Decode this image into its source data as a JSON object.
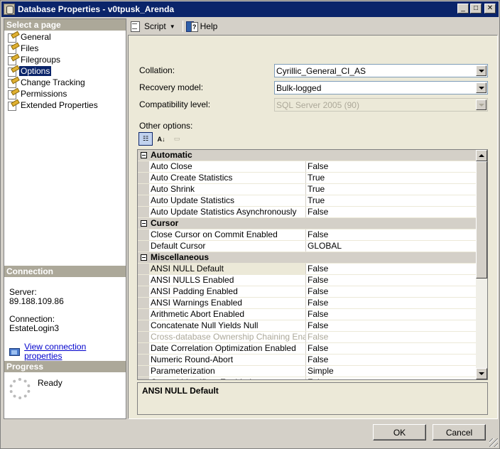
{
  "window": {
    "title": "Database Properties - v0tpusk_Arenda",
    "controls": {
      "minimize": "_",
      "maximize": "□",
      "close": "✕"
    }
  },
  "left": {
    "select_page_header": "Select a page",
    "pages": [
      {
        "label": "General",
        "icon": "page-settings-icon",
        "selected": false
      },
      {
        "label": "Files",
        "icon": "page-settings-icon",
        "selected": false
      },
      {
        "label": "Filegroups",
        "icon": "page-settings-icon",
        "selected": false
      },
      {
        "label": "Options",
        "icon": "page-settings-icon",
        "selected": true
      },
      {
        "label": "Change Tracking",
        "icon": "page-settings-icon",
        "selected": false
      },
      {
        "label": "Permissions",
        "icon": "page-settings-icon",
        "selected": false
      },
      {
        "label": "Extended Properties",
        "icon": "page-settings-icon",
        "selected": false
      }
    ],
    "connection_header": "Connection",
    "server_label": "Server:",
    "server_value": "89.188.109.86",
    "connection_label": "Connection:",
    "connection_value": "EstateLogin3",
    "view_connection_link": "View connection properties",
    "progress_header": "Progress",
    "progress_status": "Ready"
  },
  "toolbar": {
    "script_label": "Script",
    "help_label": "Help"
  },
  "form": {
    "collation_label": "Collation:",
    "collation_value": "Cyrillic_General_CI_AS",
    "recovery_label": "Recovery model:",
    "recovery_value": "Bulk-logged",
    "compat_label": "Compatibility level:",
    "compat_value": "SQL Server 2005 (90)",
    "other_options_label": "Other options:"
  },
  "grid": {
    "categories": [
      {
        "name": "Automatic",
        "rows": [
          {
            "name": "Auto Close",
            "value": "False"
          },
          {
            "name": "Auto Create Statistics",
            "value": "True"
          },
          {
            "name": "Auto Shrink",
            "value": "True"
          },
          {
            "name": "Auto Update Statistics",
            "value": "True"
          },
          {
            "name": "Auto Update Statistics Asynchronously",
            "value": "False"
          }
        ]
      },
      {
        "name": "Cursor",
        "rows": [
          {
            "name": "Close Cursor on Commit Enabled",
            "value": "False"
          },
          {
            "name": "Default Cursor",
            "value": "GLOBAL"
          }
        ]
      },
      {
        "name": "Miscellaneous",
        "rows": [
          {
            "name": "ANSI NULL Default",
            "value": "False",
            "selected": true
          },
          {
            "name": "ANSI NULLS Enabled",
            "value": "False"
          },
          {
            "name": "ANSI Padding Enabled",
            "value": "False"
          },
          {
            "name": "ANSI Warnings Enabled",
            "value": "False"
          },
          {
            "name": "Arithmetic Abort Enabled",
            "value": "False"
          },
          {
            "name": "Concatenate Null Yields Null",
            "value": "False"
          },
          {
            "name": "Cross-database Ownership Chaining Enabled",
            "value": "False",
            "disabled": true
          },
          {
            "name": "Date Correlation Optimization Enabled",
            "value": "False"
          },
          {
            "name": "Numeric Round-Abort",
            "value": "False"
          },
          {
            "name": "Parameterization",
            "value": "Simple"
          },
          {
            "name": "Quoted Identifiers Enabled",
            "value": "False"
          }
        ]
      }
    ],
    "description_title": "ANSI NULL Default"
  },
  "buttons": {
    "ok": "OK",
    "cancel": "Cancel"
  }
}
